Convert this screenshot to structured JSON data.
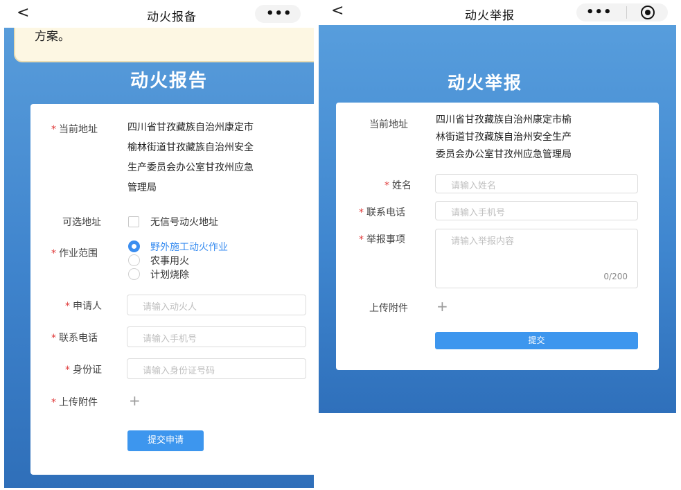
{
  "left": {
    "nav": {
      "back": "<",
      "title": "动火报备",
      "more": "•••"
    },
    "notice_tail": "方案。",
    "title": "动火报告",
    "form": {
      "address_label": "当前地址",
      "address_lines": [
        "四川省甘孜藏族自治州康定市",
        "榆林街道甘孜藏族自治州安全",
        "生产委员会办公室甘孜州应急",
        "管理局"
      ],
      "optional_address_label": "可选地址",
      "optional_address_option": "无信号动火地址",
      "scope_label": "作业范围",
      "scope_options": [
        "野外施工动火作业",
        "农事用火",
        "计划烧除"
      ],
      "applicant_label": "申请人",
      "applicant_placeholder": "请输入动火人",
      "phone_label": "联系电话",
      "phone_placeholder": "请输入手机号",
      "id_label": "身份证",
      "id_placeholder": "请输入身份证号码",
      "attachment_label": "上传附件",
      "attachment_plus": "+",
      "submit_label": "提交申请"
    }
  },
  "right": {
    "nav": {
      "back": "<",
      "title": "动火举报",
      "more": "•••"
    },
    "title": "动火举报",
    "form": {
      "address_label": "当前地址",
      "address_lines": [
        "四川省甘孜藏族自治州康定市榆",
        "林街道甘孜藏族自治州安全生产",
        "委员会办公室甘孜州应急管理局"
      ],
      "name_label": "姓名",
      "name_placeholder": "请输入姓名",
      "phone_label": "联系电话",
      "phone_placeholder": "请输入手机号",
      "report_label": "举报事项",
      "report_placeholder": "请输入举报内容",
      "report_counter": "0/200",
      "attachment_label": "上传附件",
      "attachment_plus": "+",
      "submit_label": "提交"
    }
  },
  "colors": {
    "primary_blue": "#3d96ee",
    "required_star": "#e03a3a",
    "notice_background": "#fdf7e3"
  }
}
